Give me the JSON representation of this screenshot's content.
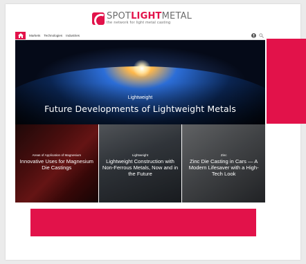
{
  "brand": {
    "name_part1": "SPOT",
    "name_part2": "LIGHT",
    "name_part3": "METAL",
    "tagline": "the network for light metal casting",
    "accent_color": "#e2124a"
  },
  "nav": {
    "home_icon": "home-icon",
    "items": [
      {
        "label": "Markets"
      },
      {
        "label": "Technologies"
      },
      {
        "label": "Industries"
      }
    ],
    "user_icon": "user-icon",
    "search_icon": "search-icon"
  },
  "hero": {
    "kicker": "Lightweight",
    "title": "Future Developments of Lightweight Metals"
  },
  "tiles": [
    {
      "kicker": "Areas of Application of Magnesium",
      "title": "Innovative Uses for Magnesium Die Castings"
    },
    {
      "kicker": "Lightweight",
      "title": "Lightweight Construction with Non-Ferrous Metals, Now and in the Future"
    },
    {
      "kicker": "Zinc",
      "title": "Zinc Die Casting in Cars — A Modern Lifesaver with a High-Tech Look"
    }
  ]
}
